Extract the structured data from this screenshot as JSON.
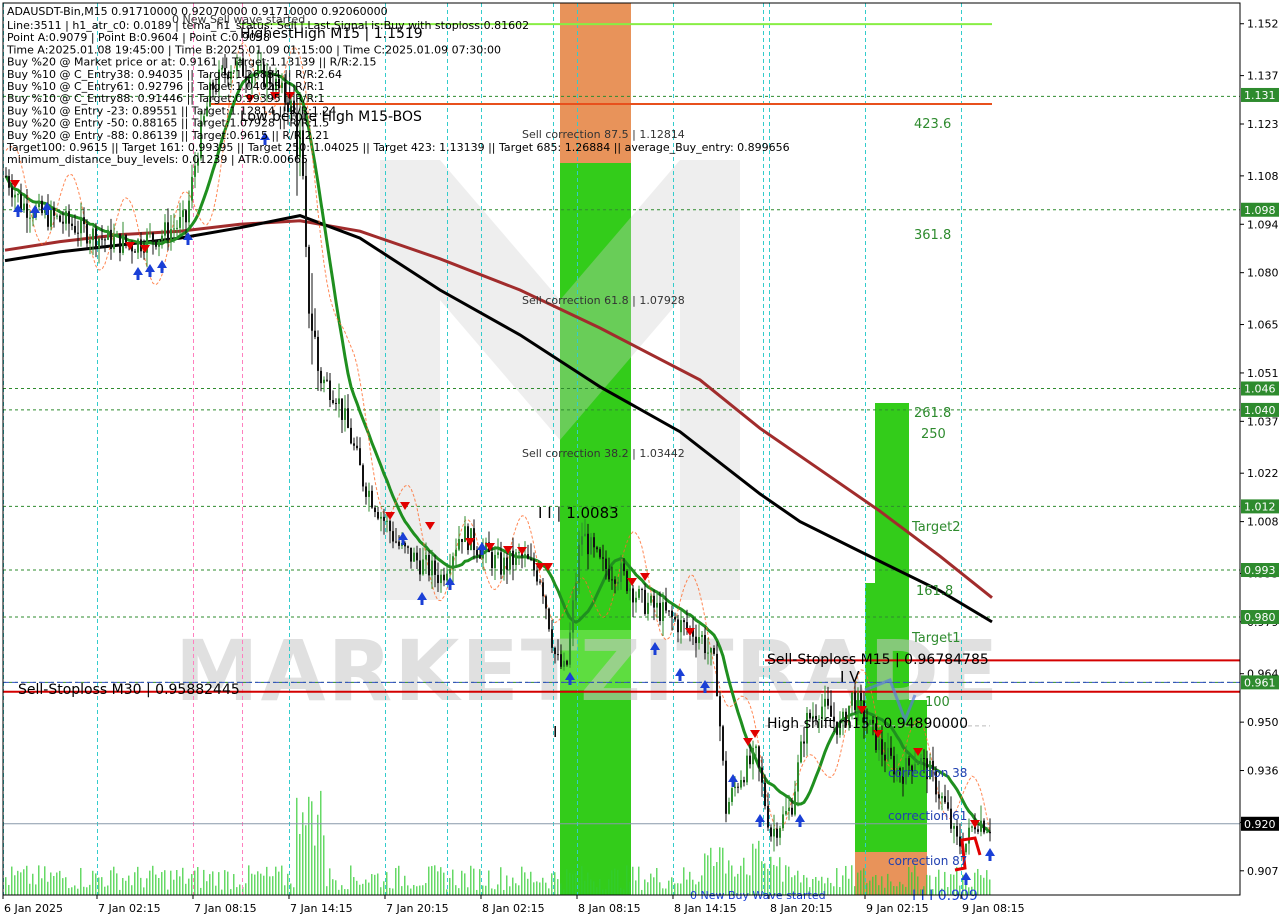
{
  "chart_data": {
    "type": "candlestick",
    "symbol_header": "ADAUSDT-Bin,M15  0.91710000 0.92070000 0.91710000 0.92060000",
    "info_lines": [
      "Line:3511 | h1_atr_c0: 0.0189 | tema_h1_status: Sell | Last Signal is:Buy with stoploss:0.81602",
      "Point A:0.9079 | Point B:0.9604 | Point C:0.9058",
      "Time A:2025.01.08 19:45:00 | Time B:2025.01.09 01:15:00 | Time C:2025.01.09 07:30:00",
      "Buy %20 @ Market price or at: 0.9161 || Target:1.13139 || R/R:2.15",
      "Buy %10 @ C_Entry38: 0.94035 || Target:1.26884 || R/R:2.64",
      "Buy %10 @ C_Entry61: 0.92796 || Target:1.04025 || R/R:1",
      "Buy %10 @ C_Entry88: 0.91446 || Target:0.99395 || R/R:1",
      "Buy %10 @ Entry -23: 0.89551 || Target:1.12814 || R/R:1.24",
      "Buy %20 @ Entry -50: 0.88165 || Target:1.07928 || R/R:1.5",
      "Buy %20 @ Entry -88: 0.86139 || Target:0.9615 || R/R:2.21",
      "Target100: 0.9615 || Target 161: 0.99395 || Target 250: 1.04025 || Target 423: 1.13139 || Target 685: 1.26884 || average_Buy_entry: 0.899656",
      "minimum_distance_buy_levels: 0.01239 | ATR:0.00665"
    ],
    "watermark": "MARKETZITRADE",
    "y_axis": {
      "ticks": [
        "1.152",
        "1.137",
        "1.123",
        "1.108",
        "1.094",
        "1.080",
        "1.065",
        "1.051",
        "1.037",
        "1.022",
        "1.008",
        "0.993",
        "0.979",
        "0.964",
        "0.950",
        "0.936",
        "0.921",
        "0.907"
      ],
      "ylim": [
        0.9,
        1.158
      ]
    },
    "x_axis": {
      "ticks": [
        "6 Jan 2025",
        "7 Jan 02:15",
        "7 Jan 08:15",
        "7 Jan 14:15",
        "7 Jan 20:15",
        "8 Jan 02:15",
        "8 Jan 08:15",
        "8 Jan 14:15",
        "8 Jan 20:15",
        "9 Jan 02:15",
        "9 Jan 08:15"
      ]
    },
    "price_badges": [
      {
        "label": "1.131",
        "value": 1.1314,
        "color": "#2e8b2e"
      },
      {
        "label": "1.098",
        "value": 1.0982,
        "color": "#2e8b2e"
      },
      {
        "label": "1.046",
        "value": 1.0465,
        "color": "#2e8b2e"
      },
      {
        "label": "1.040",
        "value": 1.0403,
        "color": "#2e8b2e"
      },
      {
        "label": "1.012",
        "value": 1.0124,
        "color": "#2e8b2e"
      },
      {
        "label": "0.993",
        "value": 0.994,
        "color": "#2e8b2e"
      },
      {
        "label": "0.980",
        "value": 0.9804,
        "color": "#2e8b2e"
      },
      {
        "label": "0.961",
        "value": 0.9615,
        "color": "#2e8b2e"
      },
      {
        "label": "0.920",
        "value": 0.9206,
        "color": "#000000"
      }
    ],
    "level_labels": [
      {
        "text": "HighestHigh   M15 | 1.1519"
      },
      {
        "text": "Low before High   M15-BOS"
      },
      {
        "text": "Sell correction 87.5 | 1.12814"
      },
      {
        "text": "Sell correction 61.8 | 1.07928"
      },
      {
        "text": "Sell correction 38.2 | 1.03442"
      },
      {
        "text": "I I | 1.0083"
      },
      {
        "text": "I"
      },
      {
        "text": "I V"
      },
      {
        "text": "Sell-Stoploss M15 | 0.96784785"
      },
      {
        "text": "Sell-Stoploss M30 | 0.95882445"
      },
      {
        "text": "High shift m15 | 0.94890000"
      },
      {
        "text": "423.6"
      },
      {
        "text": "361.8"
      },
      {
        "text": "261.8"
      },
      {
        "text": "250"
      },
      {
        "text": "Target2"
      },
      {
        "text": "161.8"
      },
      {
        "text": "Target1"
      },
      {
        "text": "100"
      },
      {
        "text": "correction 38"
      },
      {
        "text": "correction 61"
      },
      {
        "text": "correction 87"
      },
      {
        "text": "I I I 0.909"
      },
      {
        "text": "0 New Buy Wave started"
      },
      {
        "text": "0 New Sell wave started"
      }
    ],
    "colors": {
      "up": "#2e8b2e",
      "down": "#111111",
      "sma_green": "#1f8f1f",
      "sma_black": "#000000",
      "sma_red": "#a12c2c",
      "level_green": "#2e8b2e",
      "stop_red": "#d40000",
      "zone_green": "#33cc1a",
      "zone_orange": "#e8935a",
      "volume": "#33cc33",
      "arrow_buy": "#1a3fd6",
      "arrow_sell": "#e00000"
    }
  }
}
